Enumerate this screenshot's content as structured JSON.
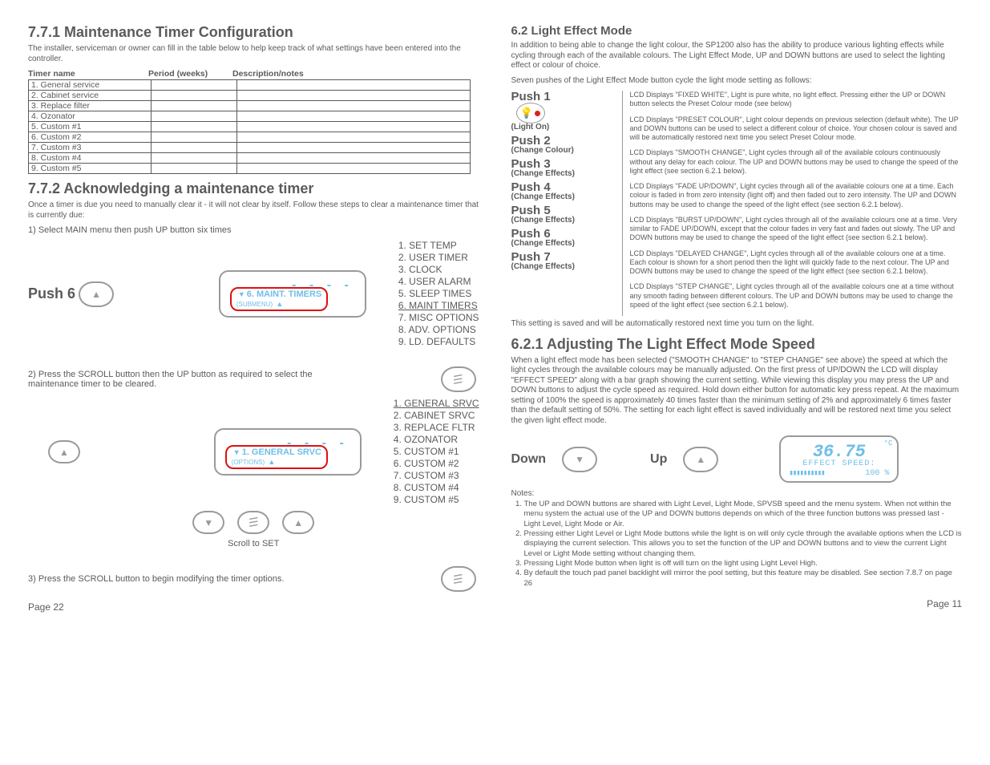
{
  "left": {
    "h1": "7.7.1  Maintenance Timer Configuration",
    "intro": "The installer, serviceman or owner can fill in the table below to help keep track of what settings have been entered into the controller.",
    "th1": "Timer name",
    "th2": "Period (weeks)",
    "th3": "Description/notes",
    "rows": [
      "1. General service",
      "2. Cabinet service",
      "3. Replace filter",
      "4. Ozonator",
      "5. Custom #1",
      "6. Custom #2",
      "7. Custom #3",
      "8. Custom #4",
      "9. Custom #5"
    ],
    "h2": "7.7.2 Acknowledging a maintenance timer",
    "intro2": "Once a timer is due you need to manually clear it - it will not clear by itself.  Follow these steps to clear a maintenance timer that is currently due:",
    "step1": "1)   Select MAIN menu then push UP button six times",
    "push6": "Push 6",
    "lcd1_line": "6.  MAINT. TIMERS",
    "lcd1_sub": "(SUBMENU)",
    "menu1": [
      "1.  SET TEMP",
      "2.  USER TIMER",
      "3.  CLOCK",
      "4.  USER ALARM",
      "5.  SLEEP TIMES",
      "6.  MAINT TIMERS",
      "7.  MISC OPTIONS",
      "8.  ADV. OPTIONS",
      "9.  LD. DEFAULTS"
    ],
    "menu1_sel": 5,
    "step2": "2)    Press the SCROLL button then the UP button as required to select the maintenance timer to be cleared.",
    "lcd2_line": "1.  GENERAL SRVC",
    "lcd2_sub": "(OPTIONS)",
    "menu2": [
      "1.  GENERAL SRVC",
      "2.  CABINET SRVC",
      "3.  REPLACE FLTR",
      "4.  OZONATOR",
      "5.  CUSTOM #1",
      "6.  CUSTOM #2",
      "7.  CUSTOM #3",
      "8.  CUSTOM #4",
      "9.  CUSTOM #5"
    ],
    "menu2_sel": 0,
    "scroll_set": "Scroll to SET",
    "step3": "3)    Press the SCROLL button to begin modifying the timer options.",
    "page": "Page 22"
  },
  "right": {
    "h1": "6.2 Light Effect Mode",
    "intro": "In addition to being able to change the light colour, the SP1200 also has the ability to produce various lighting effects while cycling through each of the available colours.  The Light Effect Mode, UP and DOWN buttons are used to select the lighting effect or colour of choice.",
    "seven": "Seven pushes of the Light Effect Mode button cycle the light mode setting as follows:",
    "pushes": [
      {
        "t": "Push 1",
        "s": "(Light On)",
        "d": "LCD Displays \"FIXED WHITE\", Light is pure white, no light effect.\nPressing either the UP or DOWN button selects the Preset Colour mode (see below)"
      },
      {
        "t": "Push 2",
        "s": "(Change Colour)",
        "d": "LCD Displays \"PRESET COLOUR\", Light colour depends on previous selection (default white).  The UP and DOWN buttons can be used to select a different colour of choice.  Your chosen colour is saved and will be automatically restored next time you select Preset Colour mode."
      },
      {
        "t": "Push 3",
        "s": "(Change Effects)",
        "d": "LCD Displays \"SMOOTH CHANGE\", Light cycles through all of the available colours continuously without any delay for each colour.  The UP and DOWN buttons may be used to change the speed of the light effect (see section 6.2.1 below)."
      },
      {
        "t": "Push 4",
        "s": "(Change Effects)",
        "d": "LCD Displays \"FADE UP/DOWN\", Light cycles through all of the available colours one at a time.  Each colour is faded in from zero intensity (light off) and then faded out to zero intensity.  The UP and DOWN buttons may be used to change the speed of the light effect (see section 6.2.1 below)."
      },
      {
        "t": "Push 5",
        "s": "(Change Effects)",
        "d": "LCD Displays \"BURST UP/DOWN\", Light cycles through all of the available colours one at a time.  Very similar to FADE UP/DOWN, except that the colour fades in very fast and fades out slowly.  The UP and DOWN buttons may be used to change the speed of the light effect (see section 6.2.1 below)."
      },
      {
        "t": "Push 6",
        "s": "(Change Effects)",
        "d": "LCD Displays \"DELAYED CHANGE\", Light cycles through all of the available colours one at a time.  Each colour is shown for a short period then the light will quickly fade to the next colour.  The UP and DOWN buttons may be used to change the speed of the light effect (see section 6.2.1 below)."
      },
      {
        "t": "Push 7",
        "s": "(Change Effects)",
        "d": "LCD Displays \"STEP CHANGE\", Light cycles through all of the available colours one at a time without any smooth fading between different colours.  The UP and DOWN buttons may be used to change the speed of the light effect (see section 6.2.1 below)."
      }
    ],
    "saved": "This setting is saved and will be automatically restored next time you turn on the light.",
    "h2": "6.2.1 Adjusting The Light Effect Mode Speed",
    "p2": "When a light effect mode has been selected (\"SMOOTH CHANGE\" to \"STEP CHANGE\" see above) the speed at which the light cycles through the available colours may be manually adjusted.  On the first press of UP/DOWN the LCD will display \"EFFECT SPEED\" along with a bar graph showing the current setting. While viewing this display you may press the UP and DOWN buttons to adjust the cycle speed as required.  Hold down either button for automatic key press repeat.  At the maximum setting of 100% the speed is approximately 40 times faster than the minimum setting of 2% and approximately 6 times faster than the default setting of 50%. The setting for each light effect is saved individually and will be restored next time you select the given light effect mode.",
    "down": "Down",
    "up": "Up",
    "lcd": {
      "temp": "36.75",
      "label": "EFFECT SPEED:",
      "bar": "▮▮▮▮▮▮▮▮▮▮",
      "pct": "100 %",
      "deg": "°C"
    },
    "notes_hd": "Notes:",
    "notes": [
      "The UP and DOWN buttons are shared with Light Level, Light Mode, SPVSB speed and the menu system.  When not within the menu system the actual use of the UP and DOWN buttons depends on which of the three function buttons was pressed last - Light Level, Light Mode or Air.",
      "Pressing either Light Level or Light Mode buttons while the light is on will only cycle through the available options when the LCD is displaying the current selection.  This allows you to set the function of the UP and DOWN buttons and to view the current Light Level or Light Mode setting without changing them.",
      "Pressing Light Mode button when light is off will turn on the light using Light Level High.",
      "By default the touch pad panel backlight will mirror the pool setting, but this feature may be disabled.  See section 7.8.7 on page 26"
    ],
    "page": "Page 11"
  }
}
